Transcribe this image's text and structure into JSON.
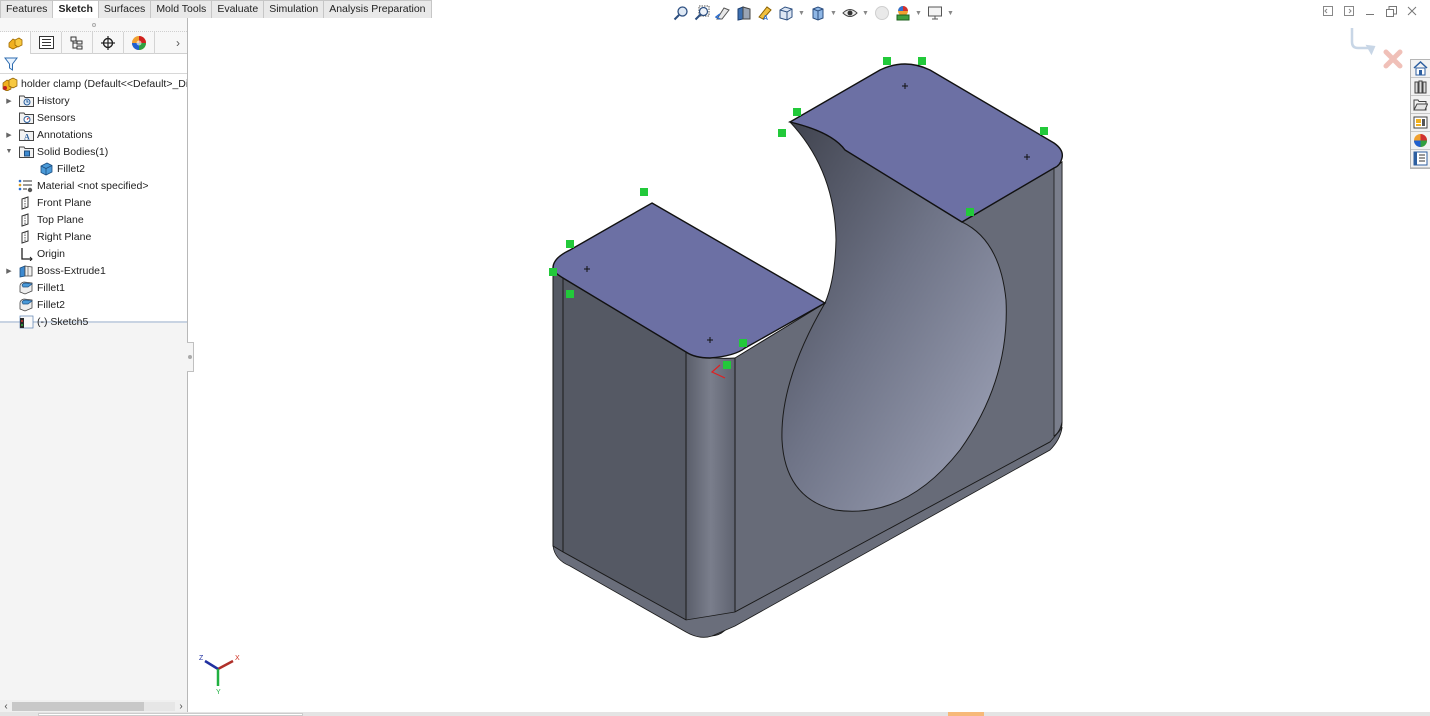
{
  "command_manager": {
    "tabs": [
      {
        "label": "Features",
        "active": false
      },
      {
        "label": "Sketch",
        "active": true
      },
      {
        "label": "Surfaces",
        "active": false
      },
      {
        "label": "Mold Tools",
        "active": false
      },
      {
        "label": "Evaluate",
        "active": false
      },
      {
        "label": "Simulation",
        "active": false
      },
      {
        "label": "Analysis Preparation",
        "active": false
      }
    ]
  },
  "manager_tabs": [
    {
      "icon": "feature-manager-icon",
      "active": true
    },
    {
      "icon": "property-manager-icon",
      "active": false
    },
    {
      "icon": "configuration-manager-icon",
      "active": false
    },
    {
      "icon": "dimxpert-manager-icon",
      "active": false
    },
    {
      "icon": "display-manager-icon",
      "active": false
    }
  ],
  "feature_tree": {
    "root_label": "holder clamp  (Default<<Default>_Displa",
    "items": [
      {
        "label": "History",
        "icon": "history-folder-icon",
        "expander": "collapsed"
      },
      {
        "label": "Sensors",
        "icon": "sensors-folder-icon",
        "expander": "none"
      },
      {
        "label": "Annotations",
        "icon": "annotations-folder-icon",
        "expander": "collapsed"
      },
      {
        "label": "Solid Bodies(1)",
        "icon": "solid-bodies-folder-icon",
        "expander": "expanded"
      },
      {
        "label": "Fillet2",
        "icon": "solid-body-icon",
        "expander": "none",
        "indent": 1
      },
      {
        "label": "Material <not specified>",
        "icon": "material-icon",
        "expander": "none"
      },
      {
        "label": "Front Plane",
        "icon": "plane-icon",
        "expander": "none"
      },
      {
        "label": "Top Plane",
        "icon": "plane-icon",
        "expander": "none"
      },
      {
        "label": "Right Plane",
        "icon": "plane-icon",
        "expander": "none"
      },
      {
        "label": "Origin",
        "icon": "origin-icon",
        "expander": "none"
      },
      {
        "label": "Boss-Extrude1",
        "icon": "extrude-icon",
        "expander": "collapsed"
      },
      {
        "label": "Fillet1",
        "icon": "fillet-icon",
        "expander": "none"
      },
      {
        "label": "Fillet2",
        "icon": "fillet-icon",
        "expander": "none"
      },
      {
        "label": "(-) Sketch5",
        "icon": "sketch-icon",
        "expander": "none"
      }
    ]
  },
  "heads_up_toolbar": [
    {
      "icon": "zoom-to-fit-icon",
      "dropdown": false
    },
    {
      "icon": "zoom-to-area-icon",
      "dropdown": false
    },
    {
      "icon": "previous-view-icon",
      "dropdown": false
    },
    {
      "icon": "section-view-icon",
      "dropdown": false
    },
    {
      "icon": "dynamic-annotation-views-icon",
      "dropdown": false
    },
    {
      "icon": "view-orientation-icon",
      "dropdown": true
    },
    {
      "icon": "display-style-icon",
      "dropdown": true
    },
    {
      "icon": "hide-show-items-icon",
      "dropdown": true
    },
    {
      "icon": "edit-appearance-icon",
      "dropdown": false
    },
    {
      "icon": "apply-scene-icon",
      "dropdown": true
    },
    {
      "icon": "view-settings-icon",
      "dropdown": true
    }
  ],
  "task_pane": [
    {
      "icon": "solidworks-resources-icon"
    },
    {
      "icon": "design-library-icon"
    },
    {
      "icon": "file-explorer-icon"
    },
    {
      "icon": "view-palette-icon"
    },
    {
      "icon": "appearances-scenes-icon"
    },
    {
      "icon": "custom-properties-icon"
    }
  ],
  "triad": {
    "x_label": "X",
    "y_label": "Y",
    "z_label": "Z"
  },
  "colors": {
    "selected_face": "#6c70a4",
    "body_dark": "#555964",
    "body_mid": "#676b78",
    "bore": "#9aa0b6",
    "sketch_handle": "#22c93a"
  }
}
